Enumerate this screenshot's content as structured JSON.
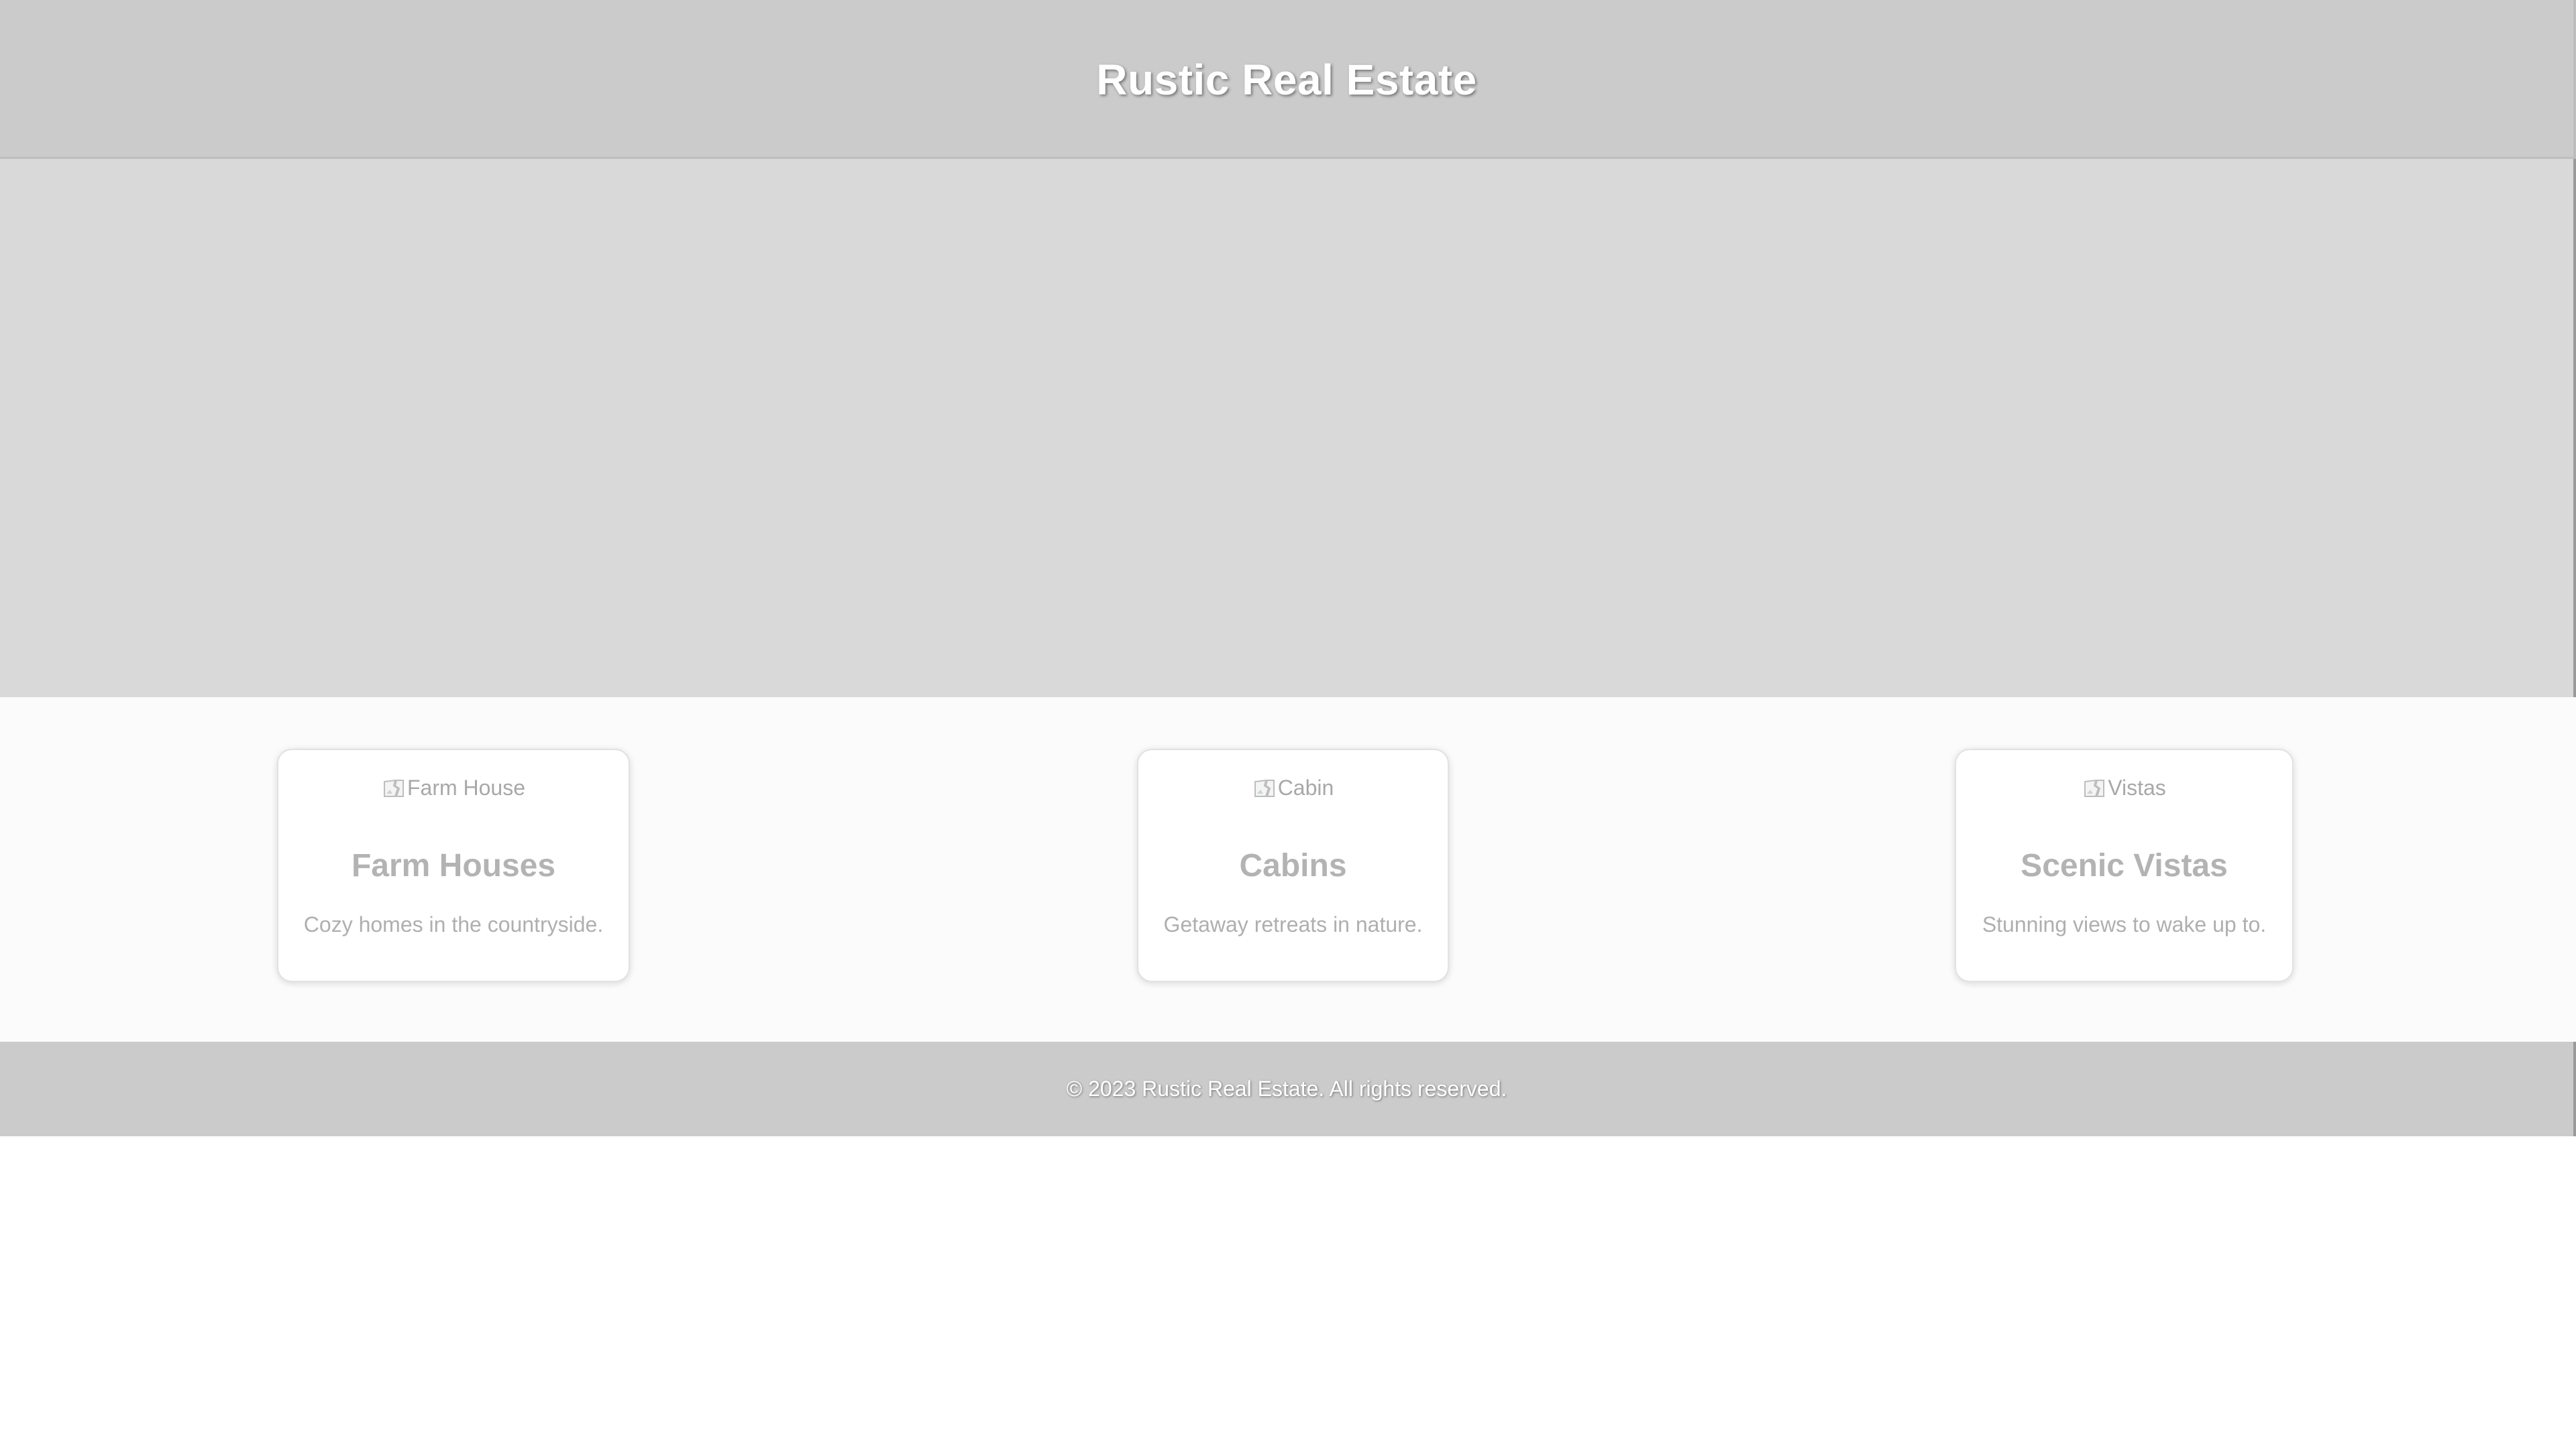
{
  "header": {
    "title": "Rustic Real Estate"
  },
  "listings": [
    {
      "image_alt": "Farm House",
      "title": "Farm Houses",
      "description": "Cozy homes in the countryside."
    },
    {
      "image_alt": "Cabin",
      "title": "Cabins",
      "description": "Getaway retreats in nature."
    },
    {
      "image_alt": "Vistas",
      "title": "Scenic Vistas",
      "description": "Stunning views to wake up to."
    }
  ],
  "footer": {
    "copyright": "© 2023 Rustic Real Estate. All rights reserved."
  },
  "icons": {
    "image_placeholder": "broken-image-icon"
  },
  "colors": {
    "header_bg": "#cbcbcb",
    "hero_bg": "#d9d9d9",
    "listings_bg": "#fbfbfb",
    "footer_bg": "#cbcbcb",
    "title_text": "#ffffff",
    "card_text": "#b3b3b3"
  }
}
